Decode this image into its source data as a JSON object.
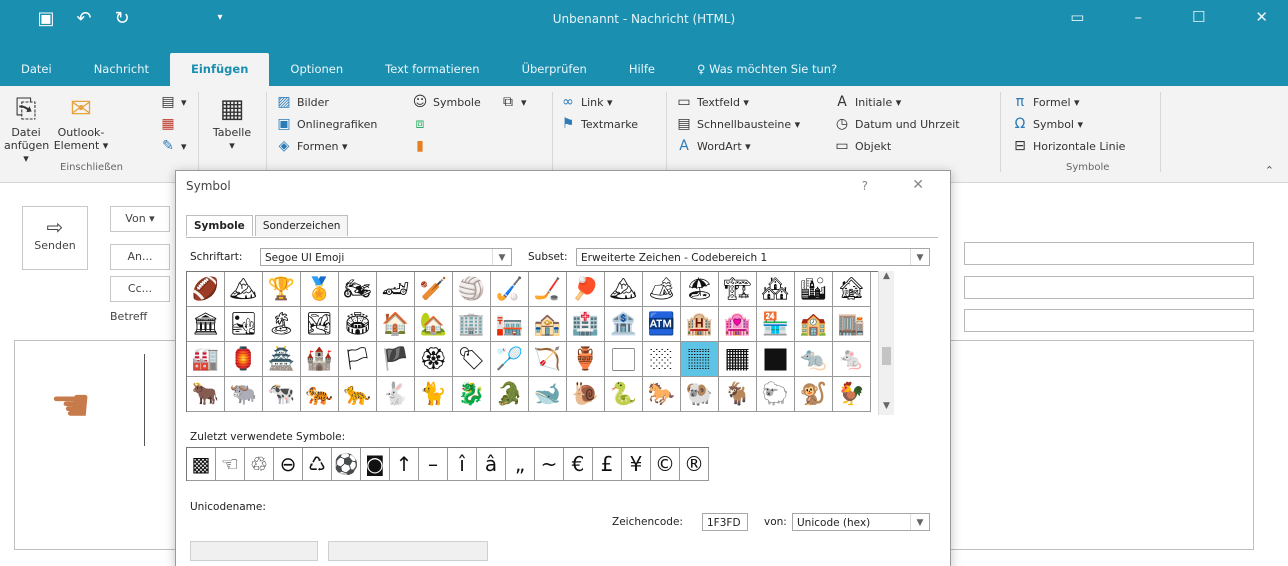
{
  "colors": {
    "accent": "#1b8fb0",
    "ribbon_bg": "#f3f3f3",
    "selected_cell": "#5ec4e6"
  },
  "window": {
    "title": "Unbenannt - Nachricht (HTML)"
  },
  "ribbon": {
    "tabs": [
      "Datei",
      "Nachricht",
      "Einfügen",
      "Optionen",
      "Text formatieren",
      "Überprüfen",
      "Hilfe",
      "Was möchten Sie tun?"
    ],
    "active_tab": "Einfügen",
    "groups": {
      "einschliessen": {
        "label": "Einschließen",
        "datei_anfuegen_1": "Datei",
        "datei_anfuegen_2": "anfügen ▾",
        "outlook_element_1": "Outlook-",
        "outlook_element_2": "Element ▾"
      },
      "tabellen": {
        "tabelle": "Tabelle",
        "tabelle_arrow": "▾"
      },
      "illustrationen": {
        "bilder": "Bilder",
        "onlinegrafiken": "Onlinegrafiken",
        "formen": "Formen ▾",
        "symbole": "Symbole"
      },
      "links": {
        "link": "Link ▾",
        "textmarke": "Textmarke"
      },
      "text": {
        "textfeld": "Textfeld ▾",
        "schnellbausteine": "Schnellbausteine ▾",
        "wordart": "WordArt ▾",
        "initiale": "Initiale ▾",
        "datum_uhrzeit": "Datum und Uhrzeit",
        "objekt": "Objekt"
      },
      "symbole": {
        "label": "Symbole",
        "formel": "Formel ▾",
        "symbol": "Symbol ▾",
        "horizontale_linie": "Horizontale Linie"
      }
    }
  },
  "compose": {
    "send_label": "Senden",
    "von": "Von ▾",
    "an": "An...",
    "cc": "Cc...",
    "betreff": "Betreff"
  },
  "dialog": {
    "title": "Symbol",
    "help": "?",
    "close": "✕",
    "tabs": [
      "Symbole",
      "Sonderzeichen"
    ],
    "active_tab": "Symbole",
    "font_label": "Schriftart:",
    "font_value": "Segoe UI Emoji",
    "subset_label": "Subset:",
    "subset_value": "Erweiterte Zeichen - Codebereich 1",
    "recent_label": "Zuletzt verwendete Symbole:",
    "unicode_name_label": "Unicodename:",
    "char_code_label": "Zeichencode:",
    "char_code_value": "1F3FD",
    "from_label": "von:",
    "from_value": "Unicode (hex)",
    "grid_rows": [
      [
        "🏈",
        "🏔",
        "🏆",
        "🏅",
        "🏍",
        "🏎",
        "🏏",
        "🏐",
        "🏑",
        "🏒",
        "🏓",
        "🏔",
        "🏕",
        "🏖",
        "🏗",
        "🏘",
        "🏙",
        "🏚"
      ],
      [
        "🏛",
        "🏜",
        "🏝",
        "🏞",
        "🏟",
        "🏠",
        "🏡",
        "🏢",
        "🏣",
        "🏤",
        "🏥",
        "🏦",
        "🏧",
        "🏨",
        "🏩",
        "🏪",
        "🏫",
        "🏬"
      ],
      [
        "🏭",
        "🏮",
        "🏯",
        "🏰",
        "🏳",
        "🏴",
        "🏵",
        "🏷",
        "🏸",
        "🏹",
        "🏺",
        "🏻",
        "🏼",
        "🏽",
        "🏾",
        "🏿",
        "🐀",
        "🐁"
      ],
      [
        "🐂",
        "🐃",
        "🐄",
        "🐅",
        "🐆",
        "🐇",
        "🐈",
        "🐉",
        "🐊",
        "🐋",
        "🐌",
        "🐍",
        "🐎",
        "🐏",
        "🐐",
        "🐑",
        "🐒",
        "🐓"
      ]
    ],
    "selected_cell": [
      2,
      13
    ],
    "recent_symbols": [
      "▩",
      "☜",
      "♲",
      "⊖",
      "♺",
      "⚽",
      "◙",
      "↑",
      "–",
      "î",
      "â",
      "„",
      "~",
      "€",
      "£",
      "¥",
      "©",
      "®"
    ]
  }
}
